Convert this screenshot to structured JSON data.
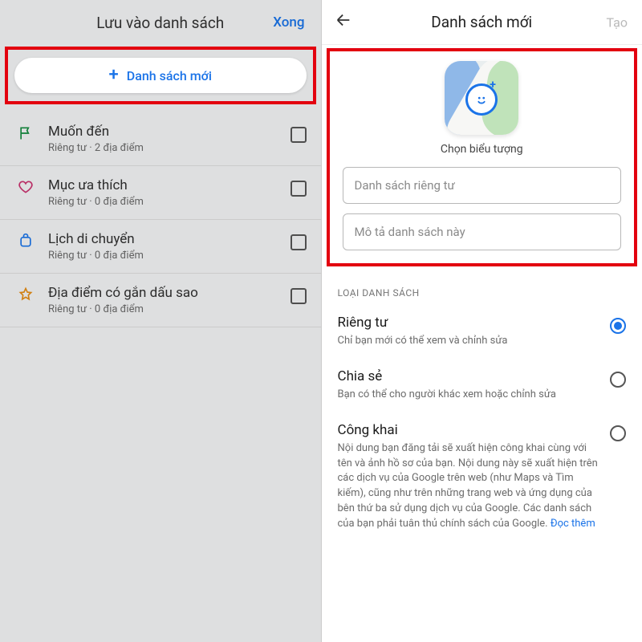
{
  "left": {
    "title": "Lưu vào danh sách",
    "done": "Xong",
    "new_list_button": "Danh sách mới",
    "items": [
      {
        "name": "Muốn đến",
        "sub": "Riêng tư · 2 địa điểm",
        "icon": "flag"
      },
      {
        "name": "Mục ưa thích",
        "sub": "Riêng tư · 0 địa điểm",
        "icon": "heart"
      },
      {
        "name": "Lịch di chuyển",
        "sub": "Riêng tư · 0 địa điểm",
        "icon": "suitcase"
      },
      {
        "name": "Địa điểm có gắn dấu sao",
        "sub": "Riêng tư · 0 địa điểm",
        "icon": "star"
      }
    ]
  },
  "right": {
    "title": "Danh sách mới",
    "create": "Tạo",
    "choose_icon": "Chọn biểu tượng",
    "field_name_placeholder": "Danh sách riêng tư",
    "field_desc_placeholder": "Mô tả danh sách này",
    "section_label": "LOẠI DANH SÁCH",
    "options": [
      {
        "title": "Riêng tư",
        "desc": "Chỉ bạn mới có thể xem và chỉnh sửa",
        "selected": true
      },
      {
        "title": "Chia sẻ",
        "desc": "Bạn có thể cho người khác xem hoặc chỉnh sửa",
        "selected": false
      },
      {
        "title": "Công khai",
        "desc": "Nội dung bạn đăng tải sẽ xuất hiện công khai cùng với tên và ảnh hồ sơ của bạn. Nội dung này sẽ xuất hiện trên các dịch vụ của Google trên web (như Maps và Tìm kiếm), cũng như trên những trang web và ứng dụng của bên thứ ba sử dụng dịch vụ của Google. Các danh sách của bạn phải tuân thủ chính sách của Google.",
        "link": "Đọc thêm",
        "selected": false
      }
    ]
  },
  "colors": {
    "accent": "#1a73e8",
    "highlight": "#e3000f"
  }
}
